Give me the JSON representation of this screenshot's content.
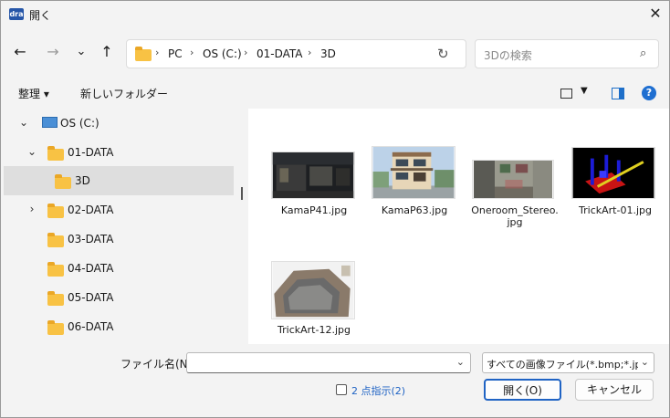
{
  "window": {
    "title": "開く",
    "app_icon_text": "dra"
  },
  "nav": {
    "back_icon": "←",
    "forward_icon": "→",
    "recent_icon": "⌄",
    "up_icon": "↑",
    "breadcrumb": [
      "PC",
      "OS (C:)",
      "01-DATA",
      "3D"
    ],
    "separator": "›",
    "refresh_icon": "↻",
    "search_placeholder": "3Dの検索",
    "search_icon": "⌕"
  },
  "toolbar": {
    "organize": "整理 ▾",
    "new_folder": "新しいフォルダー",
    "help": "?"
  },
  "tree": [
    {
      "label": "OS (C:)",
      "type": "drive",
      "expander": "⌄"
    },
    {
      "label": "01-DATA",
      "type": "folder",
      "expander": "⌄"
    },
    {
      "label": "3D",
      "type": "folder",
      "expander": "",
      "selected": true
    },
    {
      "label": "02-DATA",
      "type": "folder",
      "expander": "›"
    },
    {
      "label": "03-DATA",
      "type": "folder",
      "expander": ""
    },
    {
      "label": "04-DATA",
      "type": "folder",
      "expander": ""
    },
    {
      "label": "05-DATA",
      "type": "folder",
      "expander": ""
    },
    {
      "label": "06-DATA",
      "type": "folder",
      "expander": ""
    }
  ],
  "files": [
    {
      "name": "KamaP41.jpg"
    },
    {
      "name": "KamaP63.jpg"
    },
    {
      "name_line1": "Oneroom_Stereo.",
      "name_line2": "jpg"
    },
    {
      "name": "TrickArt-01.jpg"
    },
    {
      "name": "TrickArt-12.jpg"
    }
  ],
  "bottom": {
    "filename_label": "ファイル名(N):",
    "filename_value": "",
    "filename_dropdown_icon": "⌄",
    "filter_value": "すべての画像ファイル(*.bmp;*.jpg;",
    "filter_dropdown_icon": "⌄",
    "multi_select_label": "2 点指示(2)",
    "open_button": "開く(O)",
    "cancel_button": "キャンセル"
  },
  "colors": {
    "accent": "#1f63c4",
    "folder": "#f8c244",
    "selected_row": "#dedede"
  }
}
